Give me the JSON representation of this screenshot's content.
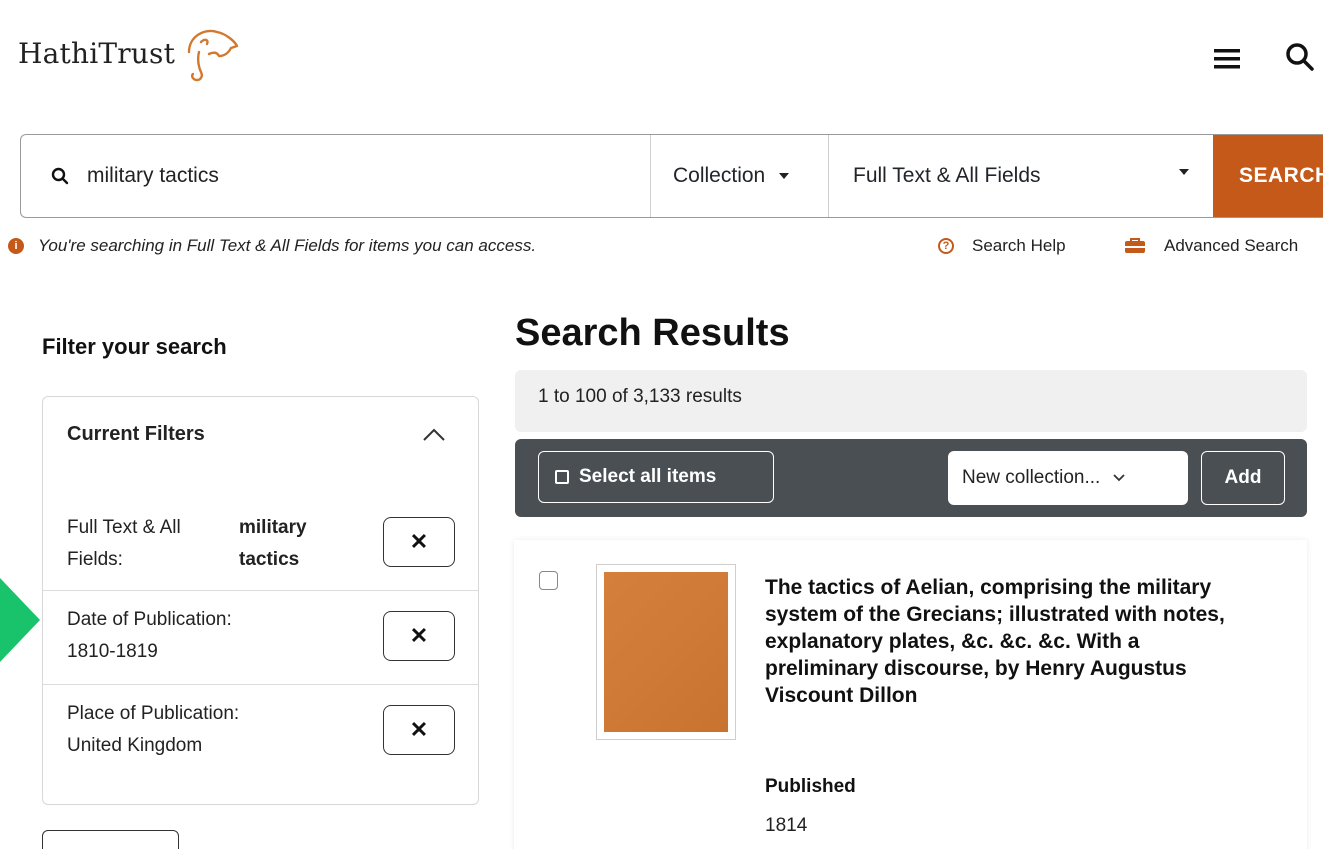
{
  "header": {
    "logo_text": "HathiTrust",
    "menu_icon": "hamburger-menu-icon",
    "search_icon": "search-icon"
  },
  "search": {
    "query": "military tactics",
    "collection_label": "Collection",
    "field_label": "Full Text & All Fields",
    "button_label": "SEARCH"
  },
  "info": {
    "message": "You're searching in Full Text & All Fields for items you can access.",
    "help_label": "Search Help",
    "advanced_label": "Advanced Search"
  },
  "filters": {
    "title": "Filter your search",
    "current_filters_label": "Current Filters",
    "items": [
      {
        "label_line1": "Full Text & All",
        "label_line2": "Fields:",
        "value_line1": "military",
        "value_line2": "tactics",
        "remove_label": "✕"
      },
      {
        "label_line1": "Date of Publication:",
        "label_line2": "1810-1819",
        "remove_label": "✕"
      },
      {
        "label_line1": "Place of Publication:",
        "label_line2": "United Kingdom",
        "remove_label": "✕"
      }
    ]
  },
  "results": {
    "title": "Search Results",
    "count_text": "1 to 100 of 3,133 results",
    "select_all_label": "Select all items",
    "collection_select_label": "New collection...",
    "add_label": "Add",
    "items": [
      {
        "title": "The tactics of Aelian, comprising the military system of the Grecians; illustrated with notes, explanatory plates, &c. &c. &c. With a preliminary discourse, by Henry Augustus Viscount Dillon",
        "published_label": "Published",
        "published_value": "1814"
      }
    ]
  },
  "colors": {
    "accent": "#c4591a",
    "toolbar": "#4a4f54",
    "annotation_arrow": "#19c36b"
  }
}
